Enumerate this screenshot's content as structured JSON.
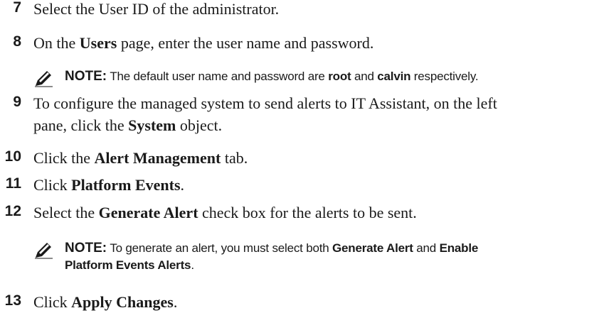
{
  "steps": [
    {
      "number": "7",
      "segments": [
        "Select the User ID of the administrator."
      ]
    },
    {
      "number": "8",
      "segments": [
        "On the ",
        "Users",
        " page, enter the user name and password."
      ]
    },
    {
      "number": "9",
      "line1": [
        "To configure the managed system to send alerts to IT Assistant, on the left"
      ],
      "line2": [
        "pane, click the ",
        "System",
        " object."
      ]
    },
    {
      "number": "10",
      "segments": [
        "Click the ",
        "Alert Management",
        " tab."
      ]
    },
    {
      "number": "11",
      "segments": [
        "Click ",
        "Platform Events",
        "."
      ]
    },
    {
      "number": "12",
      "segments": [
        "Select the ",
        "Generate Alert",
        " check box for the alerts to be sent."
      ]
    },
    {
      "number": "13",
      "segments": [
        "Click ",
        "Apply Changes",
        "."
      ]
    }
  ],
  "notes": [
    {
      "label": "NOTE:",
      "line1": [
        " The default user name and password are ",
        "root",
        " and ",
        "calvin",
        " respectively."
      ]
    },
    {
      "label": "NOTE:",
      "line1": [
        " To generate an alert, you must select both ",
        "Generate Alert",
        " and ",
        "Enable"
      ],
      "line2": [
        "Platform Events Alerts",
        "."
      ]
    }
  ],
  "icons": {
    "note_icon": "pencil-icon"
  }
}
